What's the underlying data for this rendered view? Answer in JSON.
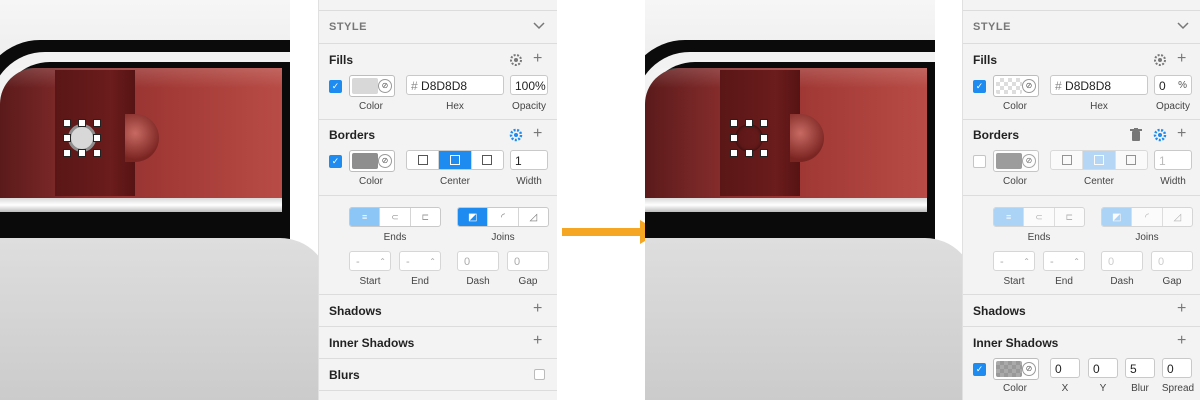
{
  "colors": {
    "accent": "#1d8bf0",
    "arrow": "#f5a623",
    "panel_bg": "#f3f3f3"
  },
  "before": {
    "section_header": "STYLE",
    "fills": {
      "title": "Fills",
      "hex_prefix": "#",
      "hex": "D8D8D8",
      "opacity": "100%",
      "color_label": "Color",
      "hex_label": "Hex",
      "opacity_label": "Opacity",
      "swatch": "#d8d8d8"
    },
    "borders": {
      "title": "Borders",
      "width": "1",
      "color_label": "Color",
      "position_label": "Center",
      "width_label": "Width",
      "ends_label": "Ends",
      "joins_label": "Joins",
      "start_label": "Start",
      "end_label": "End",
      "dash_label": "Dash",
      "gap_label": "Gap",
      "start": "-",
      "end": "-",
      "dash": "0",
      "gap": "0",
      "swatch": "#8e8e8e"
    },
    "shadows": "Shadows",
    "inner_shadows": "Inner Shadows",
    "blurs": "Blurs"
  },
  "after": {
    "section_header": "STYLE",
    "fills": {
      "title": "Fills",
      "hex_prefix": "#",
      "hex": "D8D8D8",
      "opacity": "0",
      "opacity_unit": "%",
      "color_label": "Color",
      "hex_label": "Hex",
      "opacity_label": "Opacity"
    },
    "borders": {
      "title": "Borders",
      "width": "1",
      "color_label": "Color",
      "position_label": "Center",
      "width_label": "Width",
      "ends_label": "Ends",
      "joins_label": "Joins",
      "start_label": "Start",
      "end_label": "End",
      "dash_label": "Dash",
      "gap_label": "Gap",
      "start": "-",
      "end": "-",
      "dash": "0",
      "gap": "0",
      "swatch": "#8e8e8e"
    },
    "shadows": "Shadows",
    "inner_shadows": {
      "title": "Inner Shadows",
      "x": "0",
      "y": "0",
      "blur": "5",
      "spread": "0",
      "color_label": "Color",
      "x_label": "X",
      "y_label": "Y",
      "blur_label": "Blur",
      "spread_label": "Spread"
    }
  },
  "icons": {
    "chevron": "chevron-down-icon",
    "plus": "plus-icon",
    "gear": "gear-icon",
    "trash": "trash-icon",
    "check": "checkmark-icon"
  }
}
